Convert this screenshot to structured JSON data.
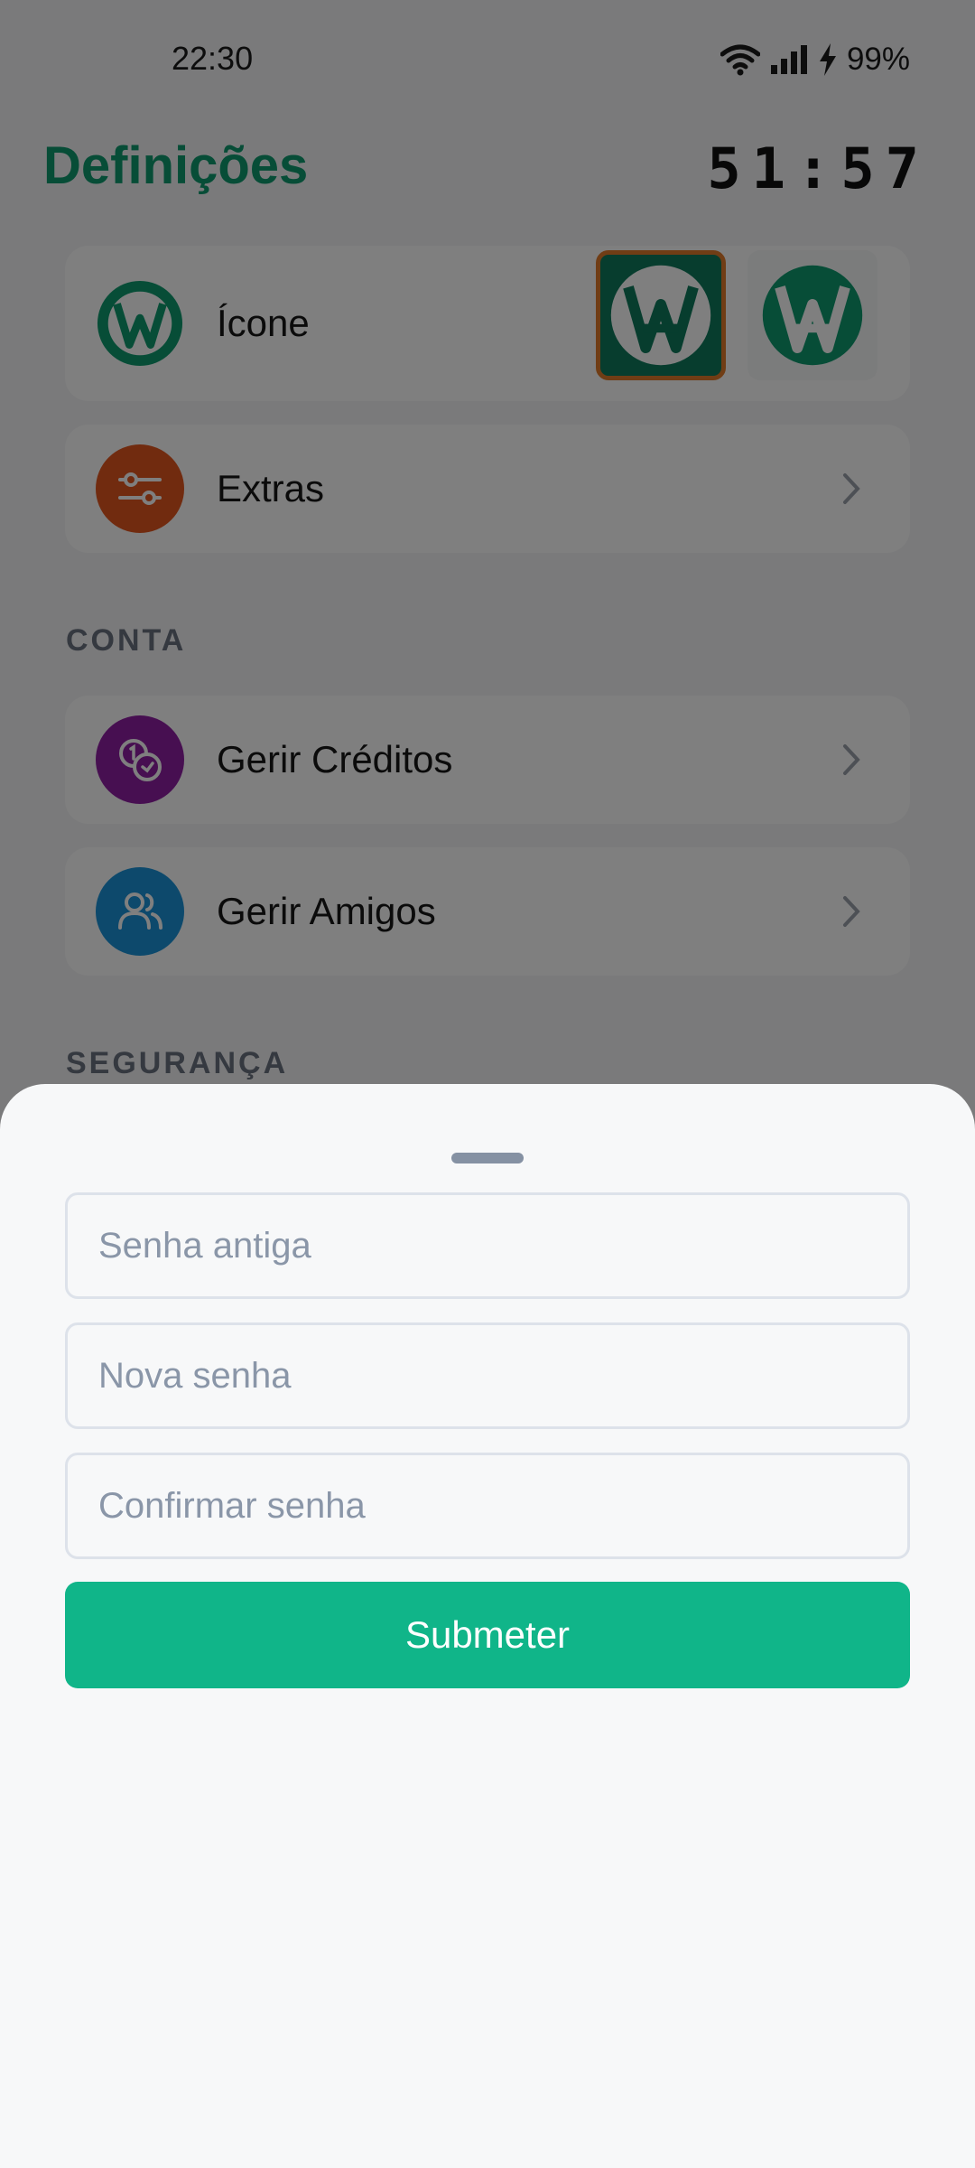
{
  "status_bar": {
    "time": "22:30",
    "battery": "99%"
  },
  "header": {
    "title": "Definições",
    "timer": "51:57"
  },
  "icon_row": {
    "label": "Ícone"
  },
  "extras_row": {
    "label": "Extras"
  },
  "sections": {
    "account": "CONTA",
    "security": "SEGURANÇA"
  },
  "account_rows": [
    {
      "label": "Gerir Créditos"
    },
    {
      "label": "Gerir Amigos"
    }
  ],
  "sheet": {
    "fields": [
      {
        "placeholder": "Senha antiga",
        "value": ""
      },
      {
        "placeholder": "Nova senha",
        "value": ""
      },
      {
        "placeholder": "Confirmar senha",
        "value": ""
      }
    ],
    "submit_label": "Submeter"
  },
  "colors": {
    "brand_green": "#0e9a6f",
    "button_green": "#10b589",
    "extras_orange": "#e2561f",
    "credits_purple": "#8e1fa3",
    "friends_blue": "#1a93d8"
  },
  "icons": {
    "app_logo": "logo-icon",
    "extras": "sliders-icon",
    "credits": "coins-icon",
    "friends": "users-icon",
    "chevron": "chevron-right-icon"
  }
}
